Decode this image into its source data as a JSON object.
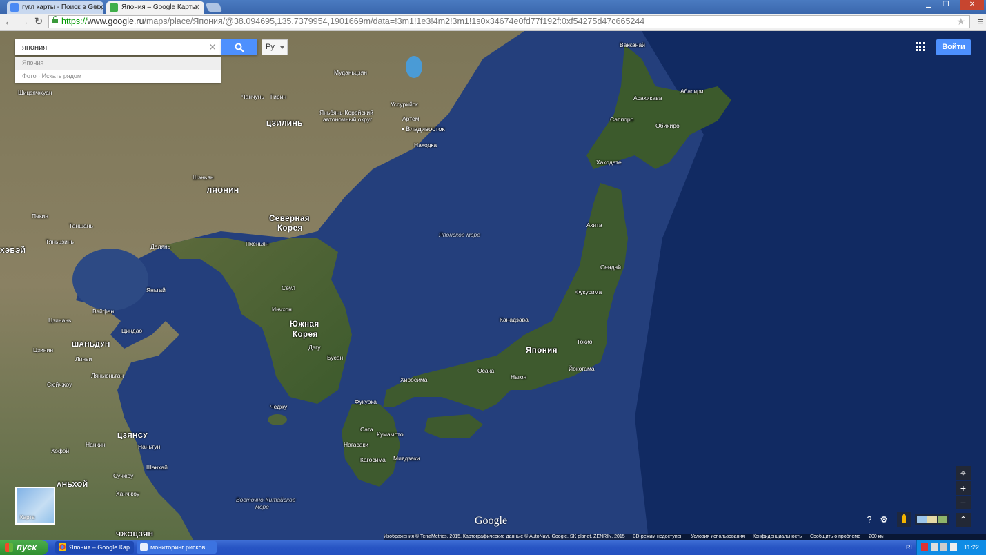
{
  "browser": {
    "tabs": [
      {
        "title": "гугл карты - Поиск в Google",
        "favicon_color": "#4a8af4"
      },
      {
        "title": "Япония – Google Карты",
        "favicon_color": "#3fae49"
      }
    ],
    "url_scheme": "https://",
    "url_host": "www.google.ru",
    "url_path": "/maps/place/Япония/@38.094695,135.7379954,1901669m/data=!3m1!1e3!4m2!3m1!1s0x34674e0fd77f192f:0xf54275d47c665244",
    "window_controls": [
      "▁",
      "❐",
      "✕"
    ]
  },
  "search": {
    "value": "япония",
    "suggestions": [
      "Япония",
      "Фото · Искать рядом"
    ],
    "language": "Ру"
  },
  "header": {
    "signin_label": "Войти"
  },
  "map": {
    "labels": {
      "japan": "Япония",
      "north_korea_1": "Северная",
      "north_korea_2": "Корея",
      "south_korea_1": "Южная",
      "south_korea_2": "Корея",
      "sea_of_japan": "Японское море",
      "east_china_sea_1": "Восточно-Китайское",
      "east_china_sea_2": "море",
      "jilin": "ЦЗИЛИНЬ",
      "liaoning": "ЛЯОНИН",
      "shandong": "ШАНЬДУН",
      "jiangsu": "ЦЗЯНСУ",
      "anhui": "АНЬХОЙ",
      "zhejiang": "ЧЖЭЦЗЯН",
      "hebei": "ХЭБЭЙ",
      "sapporo": "Саппоро",
      "asahikawa": "Асахикава",
      "abashiri": "Абасири",
      "obihiro": "Обихиро",
      "hakodate": "Хакодате",
      "akita": "Акита",
      "sendai": "Сендай",
      "fukushima": "Фукусима",
      "tokyo": "Токио",
      "yokohama": "Йокогама",
      "nagoya": "Нагоя",
      "osaka": "Осака",
      "kanazawa": "Канадзава",
      "hiroshima": "Хиросима",
      "fukuoka": "Фукуока",
      "kumamoto": "Кумамото",
      "kagoshima": "Кагосима",
      "miyazaki": "Миядзаки",
      "nagasaki": "Нагасаки",
      "saga": "Сага",
      "vladivostok": "Владивосток",
      "nakhodka": "Находка",
      "ussuriysk": "Уссурийск",
      "artem": "Артем",
      "pyongyang": "Пхеньян",
      "seoul": "Сеул",
      "incheon": "Инчхон",
      "daegu": "Дэгу",
      "busan": "Бусан",
      "jeju": "Чеджу",
      "dalian": "Далянь",
      "yantai": "Яньтай",
      "qingdao": "Циндао",
      "weifang": "Вэйфан",
      "jinan": "Цзинань",
      "beijing": "Пекин",
      "tianjin": "Тяньцзинь",
      "tangshan": "Таншань",
      "shenyang": "Шэньян",
      "nanjing": "Нанкин",
      "shanghai": "Шанхай",
      "suzhou": "Сучжоу",
      "hangzhou": "Ханчжоу",
      "hefei": "Хэфэй",
      "nantong": "Наньтун",
      "lianyungang": "Ляньюньган",
      "xuzhou": "Сюйчжоу",
      "jining": "Цзинин",
      "linyi": "Линьи",
      "yanbian_1": "Яньбянь-Корейский",
      "yanbian_2": "автономный округ",
      "changchun": "Чанчунь",
      "girin": "Гирин",
      "mudanjiang": "Муданьцзян",
      "wakkanai": "Вакканай",
      "yangquan": "Шицзячжуан"
    },
    "footer": [
      "Изображения © TerraMetrics, 2015, Картографические данные © AutoNavi, Google, SK planet, ZENRIN, 2015",
      "3D-режим недоступен",
      "Условия использования",
      "Конфиденциальность",
      "Сообщить о проблеме",
      "200 км"
    ],
    "thumbnail_label": "Карта",
    "logo": "Google",
    "zoom_in": "+",
    "zoom_out": "−"
  },
  "taskbar": {
    "start": "пуск",
    "items": [
      "Япония – Google Кар...",
      "мониторинг рисков ..."
    ],
    "lang": "RL",
    "clock": "11:22"
  }
}
